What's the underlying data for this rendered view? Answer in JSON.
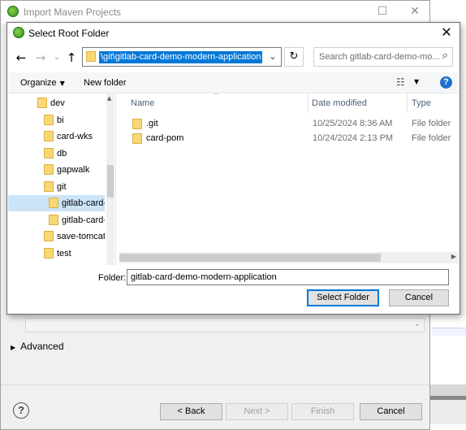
{
  "background_window": {
    "title": "Import Maven Projects",
    "advanced_label": "Advanced",
    "help_glyph": "?",
    "buttons": {
      "back": "< Back",
      "next": "Next >",
      "finish": "Finish",
      "cancel": "Cancel"
    }
  },
  "dialog": {
    "title": "Select Root Folder",
    "address_path": "\\git\\gitlab-card-demo-modern-application",
    "search_placeholder": "Search gitlab-card-demo-mo...",
    "toolbar": {
      "organize": "Organize",
      "new_folder": "New folder"
    },
    "tree": [
      {
        "label": "dev",
        "indent": 0,
        "selected": false
      },
      {
        "label": "bi",
        "indent": 1,
        "selected": false
      },
      {
        "label": "card-wks",
        "indent": 1,
        "selected": false
      },
      {
        "label": "db",
        "indent": 1,
        "selected": false
      },
      {
        "label": "gapwalk",
        "indent": 1,
        "selected": false
      },
      {
        "label": "git",
        "indent": 1,
        "selected": false
      },
      {
        "label": "gitlab-card-",
        "indent": 2,
        "selected": true
      },
      {
        "label": "gitlab-card-",
        "indent": 2,
        "selected": false
      },
      {
        "label": "save-tomcat",
        "indent": 1,
        "selected": false
      },
      {
        "label": "test",
        "indent": 1,
        "selected": false
      }
    ],
    "columns": {
      "name": "Name",
      "date_modified": "Date modified",
      "type": "Type"
    },
    "files": [
      {
        "name": ".git",
        "date": "10/25/2024 8:36 AM",
        "type": "File folder"
      },
      {
        "name": "card-pom",
        "date": "10/24/2024 2:13 PM",
        "type": "File folder"
      }
    ],
    "folder_label": "Folder:",
    "folder_value": "gitlab-card-demo-modern-application",
    "select_button": "Select Folder",
    "cancel_button": "Cancel"
  }
}
